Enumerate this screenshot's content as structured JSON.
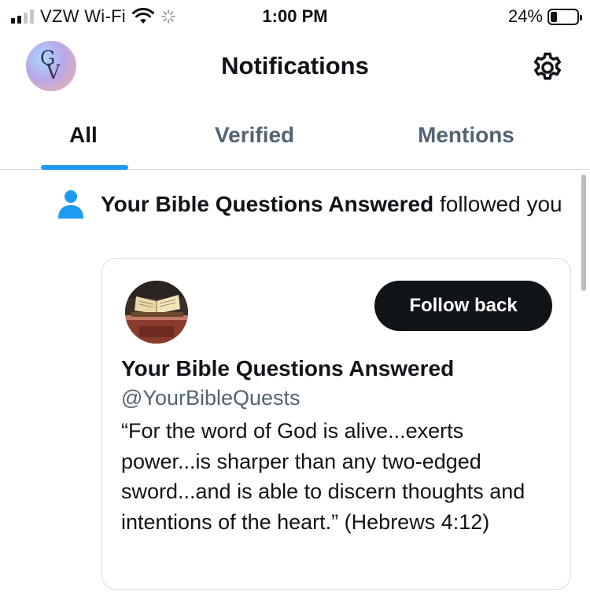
{
  "status_bar": {
    "carrier": "VZW Wi-Fi",
    "time": "1:00 PM",
    "battery_percent": "24%",
    "battery_level": 0.24,
    "signal_bars_active": 2,
    "signal_bars_total": 4,
    "icons": [
      "signal-icon",
      "wifi-icon",
      "loading-spinner-icon",
      "battery-icon"
    ]
  },
  "header": {
    "title": "Notifications",
    "avatar_letters": {
      "top": "G",
      "bottom": "V"
    },
    "settings_icon": "gear-icon"
  },
  "tabs": [
    {
      "label": "All",
      "active": true
    },
    {
      "label": "Verified",
      "active": false
    },
    {
      "label": "Mentions",
      "active": false
    }
  ],
  "notification": {
    "icon": "person-icon",
    "actor": "Your Bible Questions Answered",
    "action": " followed you",
    "card": {
      "name": "Your Bible Questions Answered",
      "handle": "@YourBibleQuests",
      "bio": "“For the word of God is alive...exerts power...is sharper than any two-edged sword...and is able to discern thoughts and intentions of the heart.” (Hebrews 4:12)",
      "follow_button_label": "Follow back"
    }
  },
  "colors": {
    "accent": "#1d9bf0",
    "text_primary": "#0f1419",
    "text_secondary": "#536471",
    "border": "#d8dde2",
    "button_bg": "#0f1419"
  }
}
